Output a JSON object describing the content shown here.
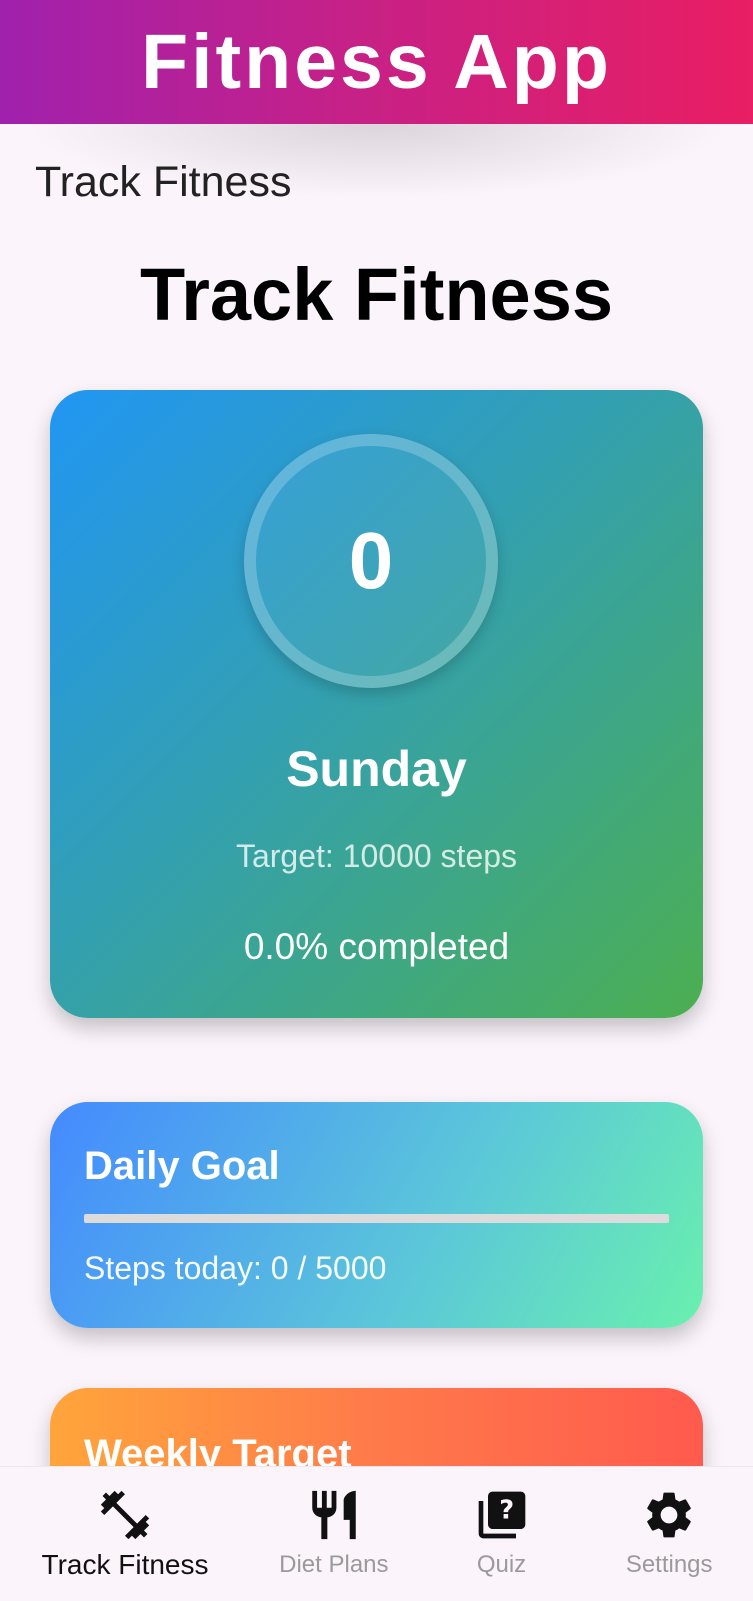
{
  "app": {
    "title": "Fitness App",
    "header_colors": [
      "#a021ad",
      "#e91e63"
    ]
  },
  "page": {
    "subtitle": "Track Fitness",
    "heading": "Track Fitness"
  },
  "steps_card": {
    "steps": "0",
    "day": "Sunday",
    "target_text": "Target: 10000 steps",
    "completed_text": "0.0% completed",
    "colors": [
      "#2196f3",
      "#4caf50"
    ]
  },
  "daily_goal": {
    "title": "Daily Goal",
    "progress_fraction": 0.0,
    "steps_text": "Steps today: 0 / 5000",
    "colors": [
      "#448aff",
      "#69f0ae"
    ]
  },
  "weekly_target": {
    "title": "Weekly Target",
    "colors": [
      "#ffa53b",
      "#ff5a4e"
    ]
  },
  "bottom_nav": {
    "items": [
      {
        "label": "Track Fitness",
        "icon": "dumbbell-icon",
        "active": true
      },
      {
        "label": "Diet Plans",
        "icon": "restaurant-icon",
        "active": false
      },
      {
        "label": "Quiz",
        "icon": "quiz-icon",
        "active": false
      },
      {
        "label": "Settings",
        "icon": "gear-icon",
        "active": false
      }
    ]
  }
}
